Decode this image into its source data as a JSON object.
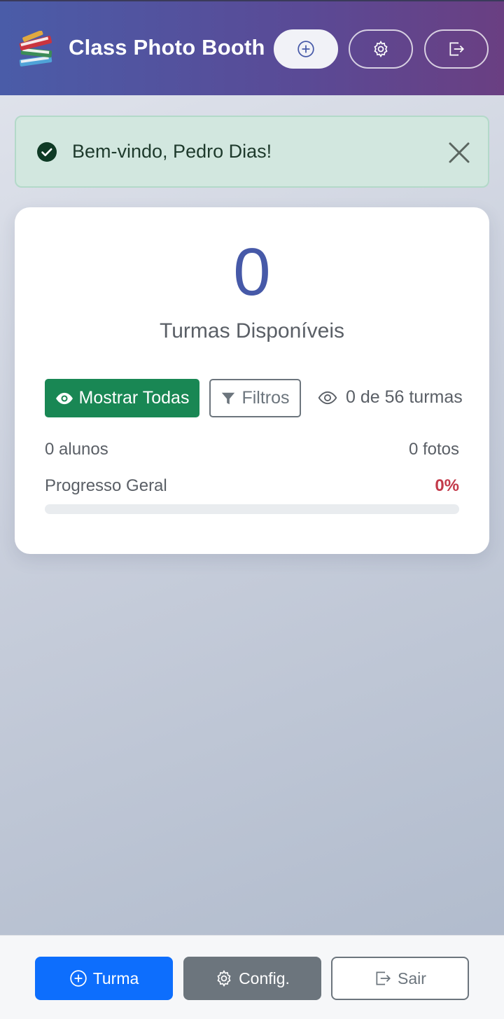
{
  "header": {
    "title": "Class Photo Booth",
    "logo_icon": "books-icon",
    "buttons": [
      {
        "name": "add-class-button",
        "icon": "plus-circle-icon"
      },
      {
        "name": "settings-button",
        "icon": "gear-icon"
      },
      {
        "name": "logout-button",
        "icon": "box-arrow-right-icon"
      }
    ]
  },
  "alert": {
    "message": "Bem-vindo, Pedro Dias!",
    "icon": "check-circle-icon",
    "close_icon": "close-icon"
  },
  "summary": {
    "count": "0",
    "count_label": "Turmas Disponíveis",
    "show_all_label": "Mostrar Todas",
    "filters_label": "Filtros",
    "visible_count": "0 de 56 turmas",
    "students": "0 alunos",
    "photos": "0 fotos",
    "progress_label": "Progresso Geral",
    "progress_percent": "0%",
    "progress_value": 0
  },
  "bottom_nav": {
    "turma_label": "Turma",
    "config_label": "Config.",
    "sair_label": "Sair"
  },
  "colors": {
    "primary": "#0d6efd",
    "success": "#198754",
    "secondary": "#6c757d",
    "accent": "#4659a8",
    "danger": "#c33a4a"
  }
}
